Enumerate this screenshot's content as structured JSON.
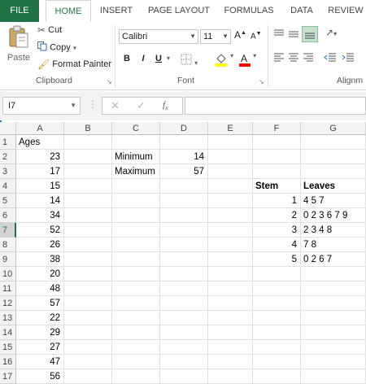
{
  "ribbon_tabs": [
    "FILE",
    "HOME",
    "INSERT",
    "PAGE LAYOUT",
    "FORMULAS",
    "DATA",
    "REVIEW"
  ],
  "clipboard": {
    "paste": "Paste",
    "cut": "Cut",
    "copy": "Copy",
    "format_painter": "Format Painter",
    "label": "Clipboard"
  },
  "font": {
    "name": "Calibri",
    "size": "11",
    "bold": "B",
    "italic": "I",
    "underline": "U",
    "label": "Font"
  },
  "alignment": {
    "label": "Alignm"
  },
  "formula_bar": {
    "name_box": "I7",
    "formula": ""
  },
  "colors": {
    "accent": "#217346",
    "selection": "#217346",
    "font_highlight": "#ffff00",
    "font_color": "#ff0000"
  },
  "columns": [
    "A",
    "B",
    "C",
    "D",
    "E",
    "F",
    "G"
  ],
  "rows": [
    [
      "Ages",
      "",
      "",
      "",
      "",
      "",
      ""
    ],
    [
      "23",
      "",
      "Minimum",
      "14",
      "",
      "",
      ""
    ],
    [
      "17",
      "",
      "Maximum",
      "57",
      "",
      "",
      ""
    ],
    [
      "15",
      "",
      "",
      "",
      "",
      "Stem",
      "Leaves"
    ],
    [
      "14",
      "",
      "",
      "",
      "",
      "1",
      "4 5 7"
    ],
    [
      "34",
      "",
      "",
      "",
      "",
      "2",
      "0 2 3 6 7 9"
    ],
    [
      "52",
      "",
      "",
      "",
      "",
      "3",
      "2 3 4 8"
    ],
    [
      "26",
      "",
      "",
      "",
      "",
      "4",
      "7 8"
    ],
    [
      "38",
      "",
      "",
      "",
      "",
      "5",
      "0 2 6 7"
    ],
    [
      "20",
      "",
      "",
      "",
      "",
      "",
      ""
    ],
    [
      "48",
      "",
      "",
      "",
      "",
      "",
      ""
    ],
    [
      "57",
      "",
      "",
      "",
      "",
      "",
      ""
    ],
    [
      "22",
      "",
      "",
      "",
      "",
      "",
      ""
    ],
    [
      "29",
      "",
      "",
      "",
      "",
      "",
      ""
    ],
    [
      "27",
      "",
      "",
      "",
      "",
      "",
      ""
    ],
    [
      "47",
      "",
      "",
      "",
      "",
      "",
      ""
    ],
    [
      "56",
      "",
      "",
      "",
      "",
      "",
      ""
    ]
  ],
  "row_numbers": [
    "1",
    "2",
    "3",
    "4",
    "5",
    "6",
    "7",
    "8",
    "9",
    "10",
    "11",
    "12",
    "13",
    "14",
    "15",
    "16",
    "17"
  ],
  "selected_row": "7"
}
